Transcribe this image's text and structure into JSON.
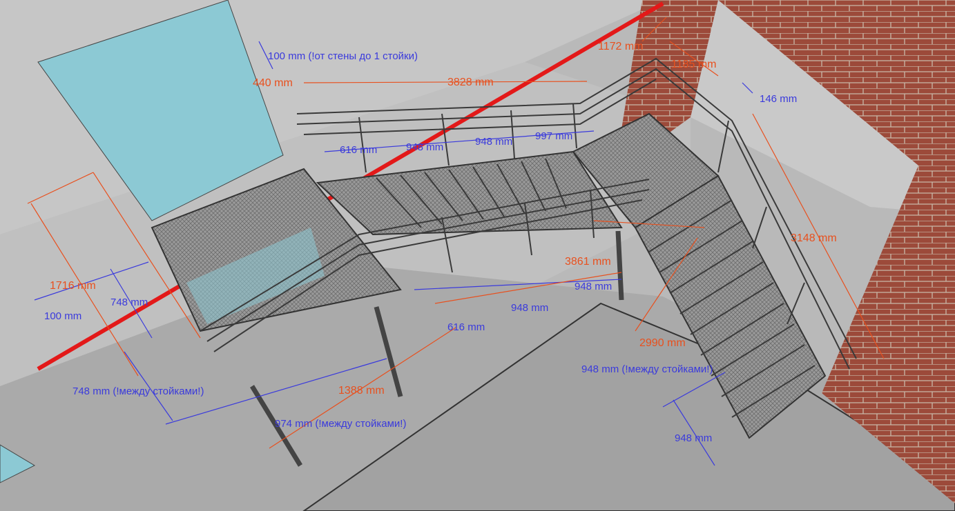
{
  "colors": {
    "wall": "#c4c4c4",
    "floor": "#a9a9a9",
    "brick": "#9c4a3a",
    "glass": "#8cc9d4",
    "frame": "#333333",
    "mesh": "#8a8a8a",
    "gas_pipe": "#e31919",
    "dim_blue": "#3a3adc",
    "dim_red": "#e8501e"
  },
  "dimensions": {
    "d_100_wall": "100 mm (!от стены до 1 стойки)",
    "d_440": "440 mm",
    "d_3828": "3828 mm",
    "d_1172": "1172 mm",
    "d_1185": "1185 mm",
    "d_146": "146 mm",
    "d_616_top": "616 mm",
    "d_948_top1": "948 mm",
    "d_948_top2": "948 mm",
    "d_997": "997 mm",
    "d_3148": "3148 mm",
    "d_1716": "1716 mm",
    "d_748": "748 mm",
    "d_100": "100 mm",
    "d_3861": "3861 mm",
    "d_948_mid1": "948 mm",
    "d_948_mid2": "948 mm",
    "d_616_bottom": "616 mm",
    "d_2990": "2990 mm",
    "d_748_between": "748 mm (!между стойками!)",
    "d_1388": "1388 mm",
    "d_974_between": "974 mm (!между стойками!)",
    "d_948_between": "948 mm (!между стойками!)",
    "d_948_bottom": "948 mm"
  }
}
